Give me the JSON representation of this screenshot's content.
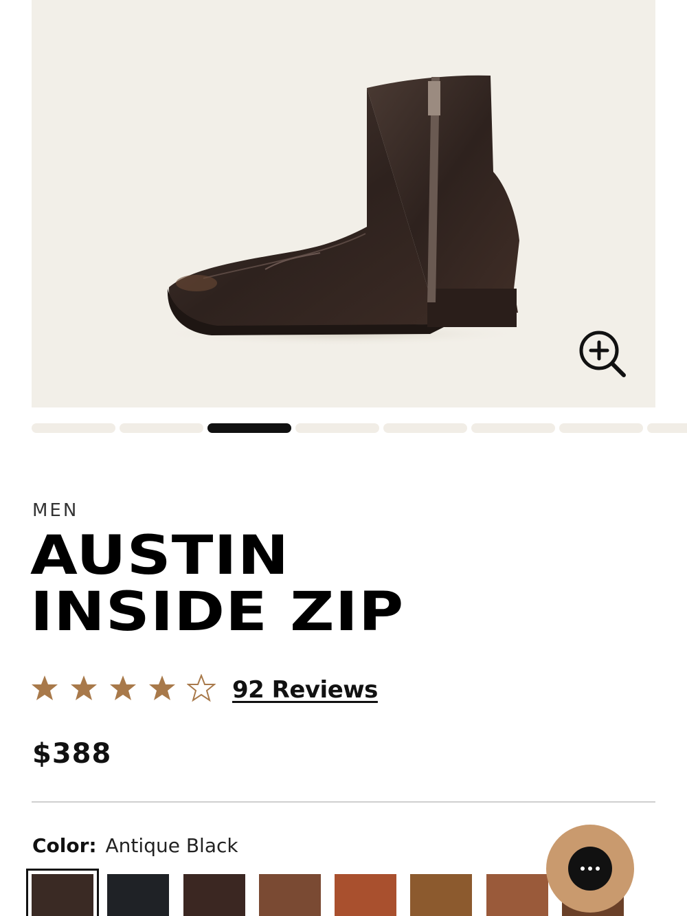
{
  "product_gallery": {
    "image_icon": "ankle-boot-photo",
    "zoom_icon": "zoom-in-icon",
    "slide_count": 8,
    "active_slide": 3
  },
  "product": {
    "category": "MEN",
    "title_line1": "AUSTIN",
    "title_line2": "INSIDE ZIP",
    "rating": 4,
    "rating_max": 5,
    "reviews_label": "92 Reviews",
    "price": "$388"
  },
  "color_selector": {
    "label": "Color:",
    "selected_value": "Antique Black",
    "swatch_colors": [
      "#3a2a24",
      "#1f2226",
      "#3b2722",
      "#7a4a33",
      "#a9502e",
      "#8c5a2e",
      "#9a5a3a",
      "#6a4028"
    ]
  },
  "chat": {
    "icon": "chat-bubble-icon"
  },
  "colors": {
    "star": "#a8794a",
    "hero_bg": "#f2efe8",
    "chat_bg": "#c99a6e",
    "pager_inactive": "#f1ede6",
    "pager_active": "#111111"
  }
}
